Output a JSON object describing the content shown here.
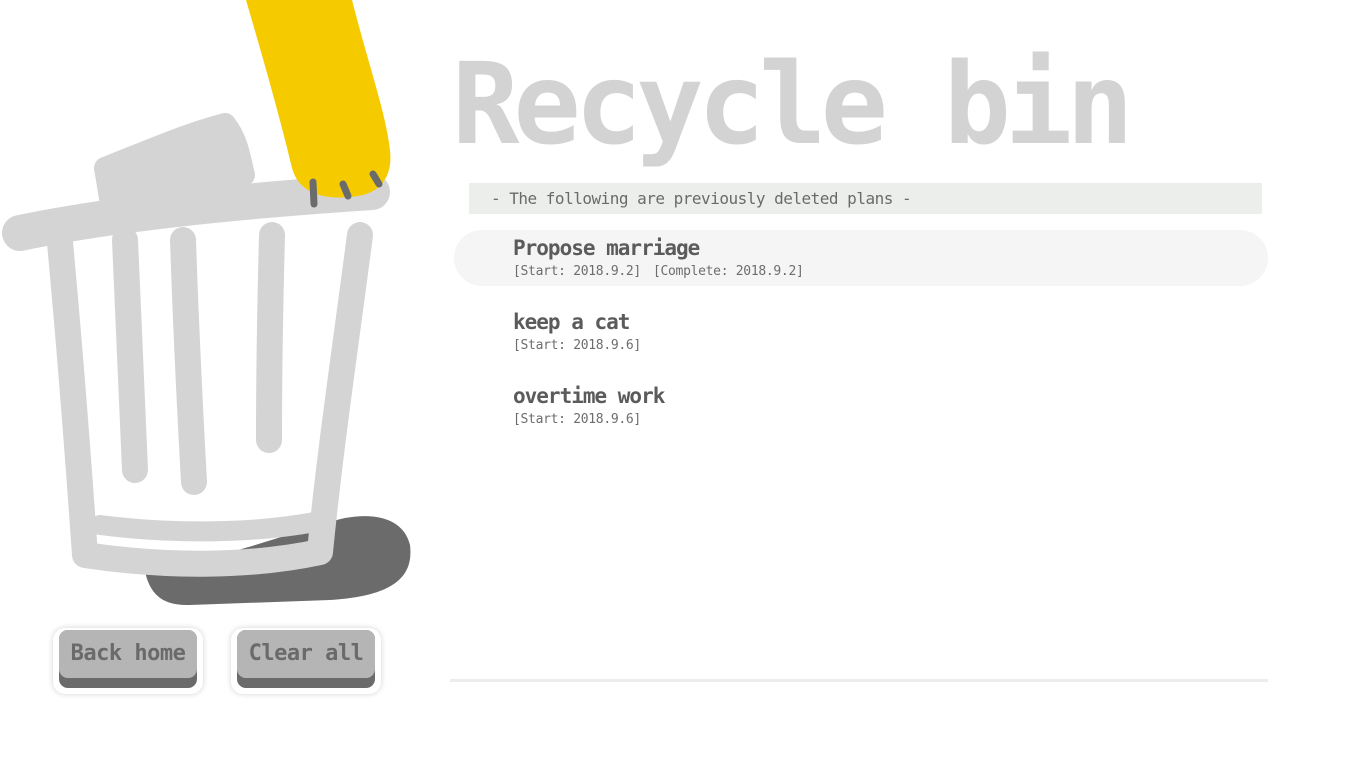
{
  "page": {
    "title": "Recycle bin",
    "subtitle": "- The following are previously deleted plans -"
  },
  "plans": [
    {
      "name": "Propose marriage",
      "start": "[Start: 2018.9.2]",
      "complete": "[Complete: 2018.9.2]",
      "highlighted": true
    },
    {
      "name": "keep a cat",
      "start": "[Start: 2018.9.6]"
    },
    {
      "name": "overtime work",
      "start": "[Start: 2018.9.6]"
    }
  ],
  "buttons": {
    "back_home": "Back home",
    "clear_all": "Clear all"
  },
  "illustration": {
    "icon": "trash-can-with-cat-paw",
    "colors": {
      "bin": "#d4d4d4",
      "paw": "#f5cb00",
      "claws": "#6b6b6b",
      "shoe": "#6b6b6b"
    }
  }
}
